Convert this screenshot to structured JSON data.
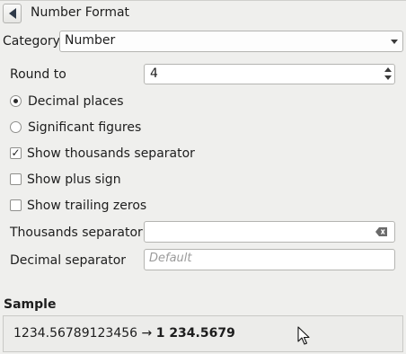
{
  "panel": {
    "title": "Number Format",
    "back_icon": "back-arrow-icon"
  },
  "category": {
    "label": "Category",
    "value": "Number"
  },
  "round_to": {
    "label": "Round to",
    "value": "4"
  },
  "options": {
    "decimal_places": {
      "label": "Decimal places",
      "selected": true
    },
    "significant_figures": {
      "label": "Significant figures",
      "selected": false
    },
    "show_thousands_separator": {
      "label": "Show thousands separator",
      "checked": true
    },
    "show_plus_sign": {
      "label": "Show plus sign",
      "checked": false
    },
    "show_trailing_zeros": {
      "label": "Show trailing zeros",
      "checked": false
    }
  },
  "thousands_separator": {
    "label": "Thousands separator",
    "value": ""
  },
  "decimal_separator": {
    "label": "Decimal separator",
    "placeholder": "Default",
    "value": ""
  },
  "sample": {
    "title": "Sample",
    "input": "1234.56789123456",
    "arrow": "→",
    "output": "1 234.5679"
  }
}
